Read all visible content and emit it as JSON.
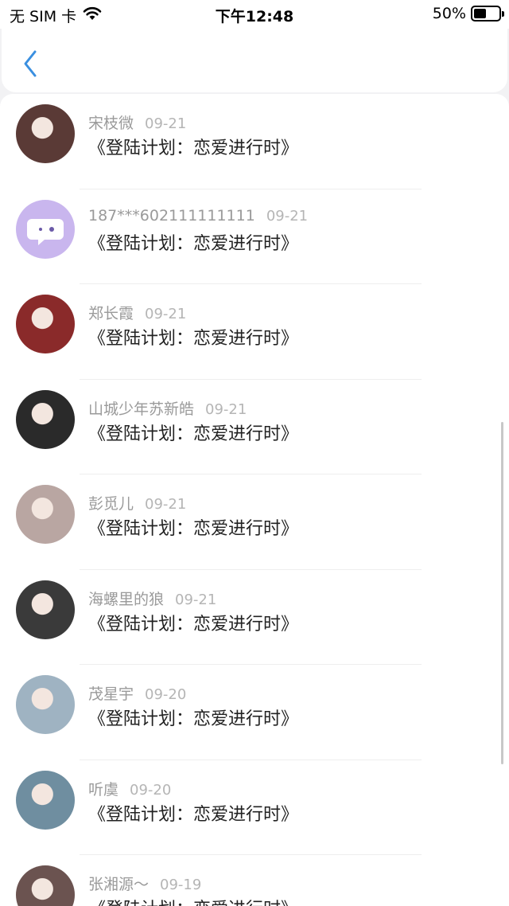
{
  "status_bar": {
    "carrier": "无 SIM 卡",
    "time": "下午12:48",
    "battery": "50%",
    "battery_level": 0.5
  },
  "nav": {
    "back_icon": "chevron-left-icon"
  },
  "items": [
    {
      "name": "宋枝微",
      "date": "09-21",
      "message": "《登陆计划：恋爱进行时》",
      "avatar_bg": "#5a3a36"
    },
    {
      "name": "187***602111111111",
      "date": "09-21",
      "message": "《登陆计划：恋爱进行时》",
      "avatar_bg": "#c9b6ee"
    },
    {
      "name": "郑长霞",
      "date": "09-21",
      "message": "《登陆计划：恋爱进行时》",
      "avatar_bg": "#8a2a2a"
    },
    {
      "name": "山城少年苏新皓",
      "date": "09-21",
      "message": "《登陆计划：恋爱进行时》",
      "avatar_bg": "#2a2a2a"
    },
    {
      "name": "彭觅儿",
      "date": "09-21",
      "message": "《登陆计划：恋爱进行时》",
      "avatar_bg": "#b9a6a2"
    },
    {
      "name": "海螺里的狼",
      "date": "09-21",
      "message": "《登陆计划：恋爱进行时》",
      "avatar_bg": "#3a3a3a"
    },
    {
      "name": "茂星宇",
      "date": "09-20",
      "message": "《登陆计划：恋爱进行时》",
      "avatar_bg": "#9fb3c2"
    },
    {
      "name": "听虞",
      "date": "09-20",
      "message": "《登陆计划：恋爱进行时》",
      "avatar_bg": "#6f8ea0"
    },
    {
      "name": "张湘源～",
      "date": "09-19",
      "message": "《登陆计划：恋爱进行时》",
      "avatar_bg": "#6b5350"
    }
  ]
}
